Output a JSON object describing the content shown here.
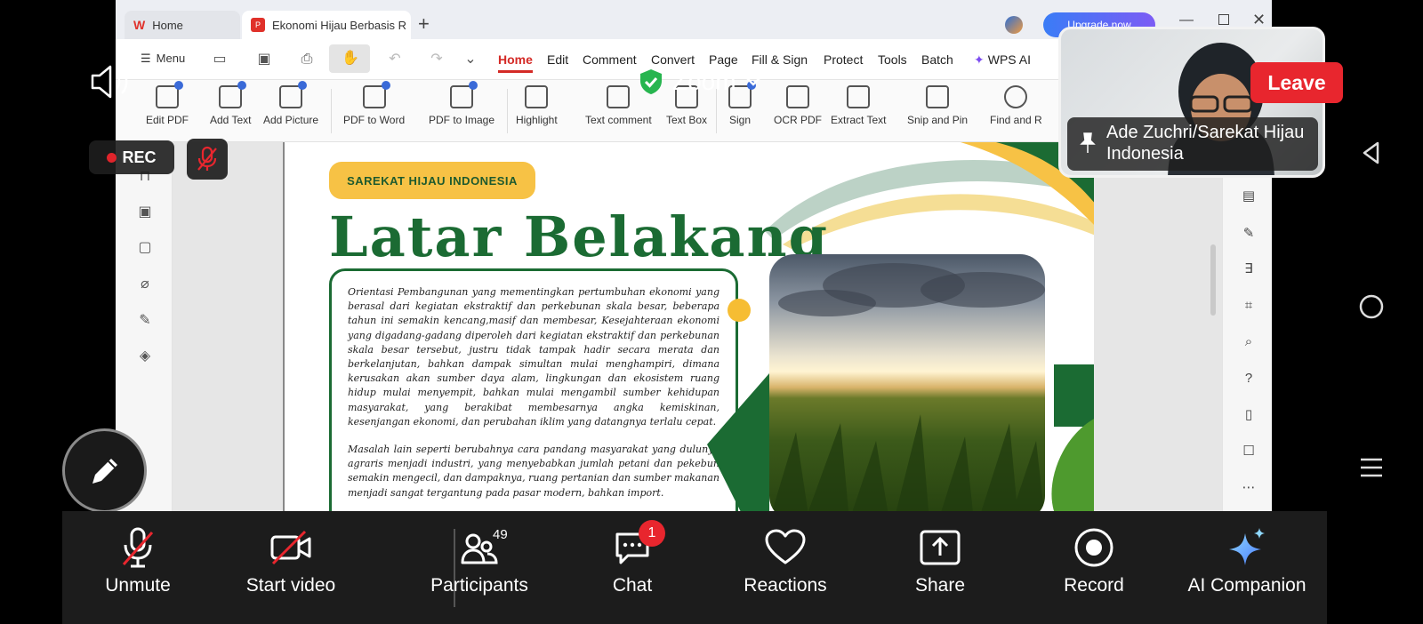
{
  "wps": {
    "tabs": [
      {
        "label": "Home"
      },
      {
        "label": "Ekonomi Hijau Berbasis Remp"
      }
    ],
    "upgrade_label": "Upgrade now",
    "menu_label": "Menu",
    "menu_items": [
      "Home",
      "Edit",
      "Comment",
      "Convert",
      "Page",
      "Fill & Sign",
      "Protect",
      "Tools",
      "Batch",
      "WPS AI"
    ],
    "ribbon": [
      "Edit PDF",
      "Add Text",
      "Add Picture",
      "PDF to Word",
      "PDF to Image",
      "Highlight",
      "Text comment",
      "Text Box",
      "Sign",
      "OCR PDF",
      "Extract Text",
      "Snip and Pin",
      "Find and R"
    ]
  },
  "document": {
    "badge": "SAREKAT HIJAU INDONESIA",
    "title": "Latar Belakang",
    "paragraph1": "Orientasi Pembangunan yang mementingkan pertumbuhan ekonomi yang berasal dari kegiatan ekstraktif dan perkebunan skala besar, beberapa tahun ini semakin kencang,masif dan membesar, Kesejahteraan ekonomi yang digadang-gadang diperoleh dari kegiatan ekstraktif dan perkebunan skala besar tersebut, justru tidak tampak hadir secara merata dan berkelanjutan, bahkan dampak simultan mulai menghampiri, dimana kerusakan akan sumber daya alam, lingkungan dan ekosistem ruang hidup mulai menyempit, bahkan mulai mengambil sumber kehidupan masyarakat, yang berakibat membesarnya angka kemiskinan, kesenjangan ekonomi, dan perubahan iklim yang datangnya terlalu cepat.",
    "paragraph2": "Masalah lain seperti berubahnya cara pandang masyarakat yang dulunya agraris menjadi industri, yang menyebabkan jumlah petani dan pekebun semakin mengecil, dan dampaknya, ruang pertanian dan sumber makanan menjadi sangat tergantung pada pasar modern, bahkan import."
  },
  "zoom": {
    "brand": "Zoom",
    "rec_label": "REC",
    "leave_label": "Leave",
    "participant_name": "Ade Zuchri/Sarekat Hijau Indonesia",
    "toolbar": {
      "unmute": "Unmute",
      "start_video": "Start video",
      "participants": "Participants",
      "participants_count": "49",
      "chat": "Chat",
      "chat_count": "1",
      "reactions": "Reactions",
      "share": "Share",
      "record": "Record",
      "ai_companion": "AI Companion"
    }
  },
  "colors": {
    "leave": "#e8262e",
    "toolbar_bg": "#1c1c1c",
    "doc_green": "#1b6b33",
    "doc_yellow": "#f7c245",
    "wps_red": "#d42a26"
  }
}
